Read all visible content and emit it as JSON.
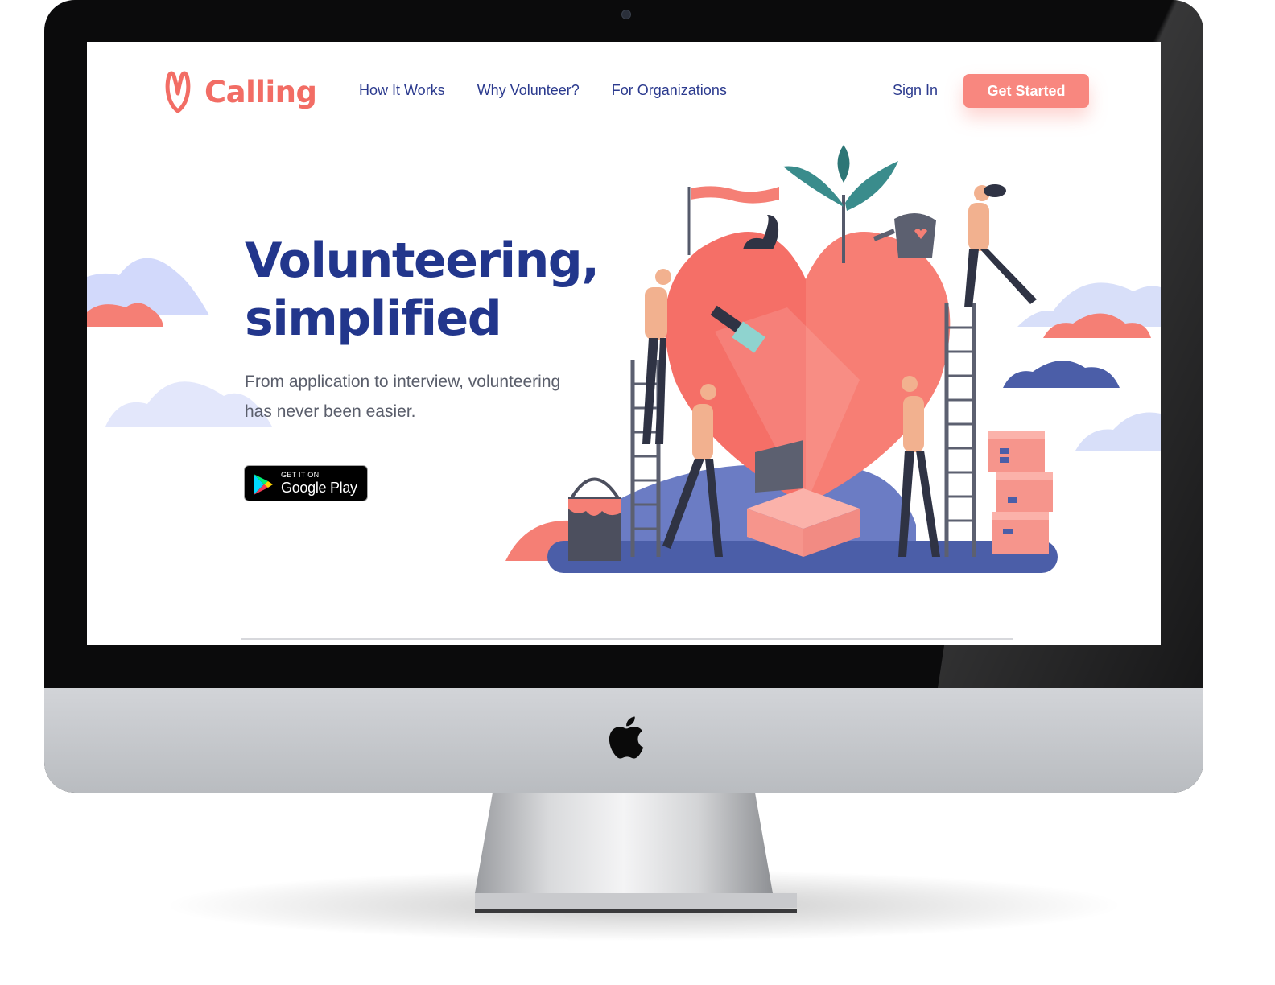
{
  "brand": {
    "name": "Calling",
    "color": "#f26d65"
  },
  "nav": {
    "links": [
      "How It Works",
      "Why Volunteer?",
      "For Organizations"
    ],
    "sign_in": "Sign In",
    "cta": "Get Started",
    "link_color": "#2b3a8e",
    "cta_color": "#f8877f"
  },
  "hero": {
    "title_line1": "Volunteering,",
    "title_line2": "simplified",
    "subtitle": "From application to interview, volunteering has never been easier.",
    "title_color": "#22368c"
  },
  "store_badge": {
    "small_text": "GET IT ON",
    "big_text": "Google Play"
  },
  "icons": {
    "logo": "heart-outline-icon",
    "play": "google-play-icon",
    "device": "apple-logo-icon"
  }
}
